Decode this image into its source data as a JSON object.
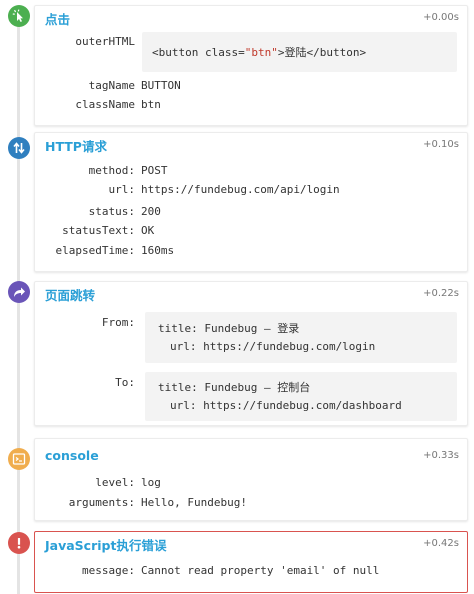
{
  "colors": {
    "accent": "#2a9fd6",
    "click_dot": "#4caf50",
    "http_dot": "#2f7fbf",
    "nav_dot": "#6a55b8",
    "console_dot": "#f0ad4e",
    "error_dot": "#d9534f",
    "error_border": "#d9534f"
  },
  "events": [
    {
      "icon": "cursor-click-icon",
      "title": "点击",
      "time": "+0.00s",
      "outer_label": "outerHTML",
      "outer_value": {
        "open": "<button class=",
        "attr": "\"btn\"",
        "close": ">登陆</button>"
      },
      "fields": [
        {
          "key": "tagName",
          "value": "BUTTON"
        },
        {
          "key": "className",
          "value": "btn"
        }
      ]
    },
    {
      "icon": "up-down-arrows-icon",
      "title": "HTTP请求",
      "time": "+0.10s",
      "fields": [
        {
          "key": "method:",
          "value": "POST"
        },
        {
          "key": "url:",
          "value": "https://fundebug.com/api/login"
        },
        {
          "key": "status:",
          "value": "200"
        },
        {
          "key": "statusText:",
          "value": "OK"
        },
        {
          "key": "elapsedTime:",
          "value": "160ms"
        }
      ]
    },
    {
      "icon": "share-arrow-icon",
      "title": "页面跳转",
      "time": "+0.22s",
      "from": {
        "label": "From:",
        "title_line": "title: Fundebug – 登录",
        "url_line": "url: https://fundebug.com/login"
      },
      "to": {
        "label": "To:",
        "title_line": "title: Fundebug – 控制台",
        "url_line": "url: https://fundebug.com/dashboard"
      }
    },
    {
      "icon": "terminal-icon",
      "title": "console",
      "time": "+0.33s",
      "fields": [
        {
          "key": "level:",
          "value": "log"
        },
        {
          "key": "arguments:",
          "value": "Hello, Fundebug!"
        }
      ]
    },
    {
      "icon": "exclamation-icon",
      "title": "JavaScript执行错误",
      "time": "+0.42s",
      "fields": [
        {
          "key": "message:",
          "value": "Cannot read property 'email' of null"
        }
      ]
    }
  ]
}
